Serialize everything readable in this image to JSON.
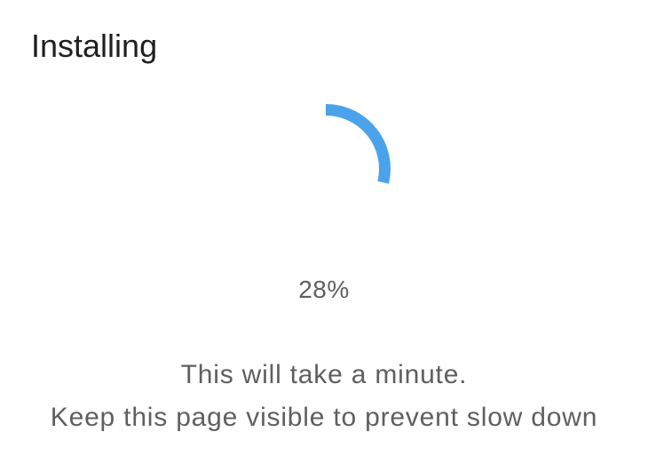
{
  "title": "Installing",
  "progress": {
    "percent_label": "28%",
    "value": 0.28,
    "color": "#4aa3ea"
  },
  "messages": [
    "This will take a minute.",
    "Keep this page visible to prevent slow down"
  ]
}
